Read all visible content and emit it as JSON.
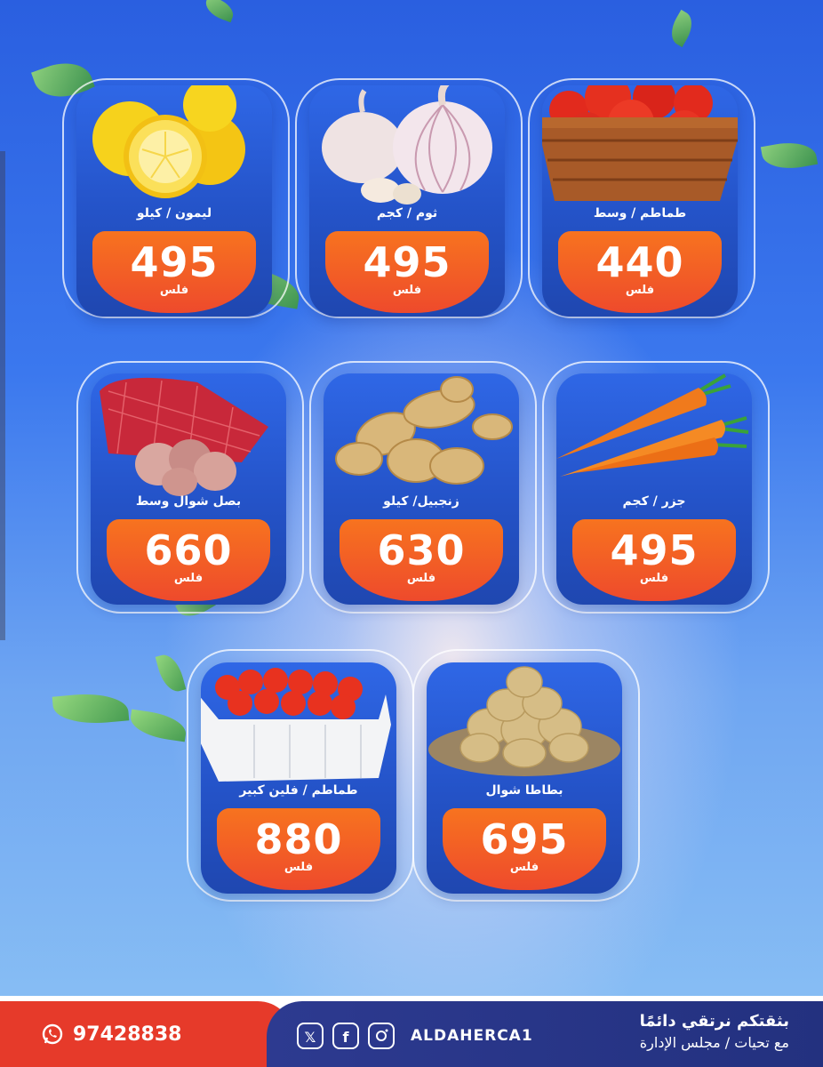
{
  "products": [
    {
      "name": "ليمون / كيلو",
      "price": "495",
      "currency": "فلس",
      "icon": "lemon-icon"
    },
    {
      "name": "ثوم / كجم",
      "price": "495",
      "currency": "فلس",
      "icon": "garlic-icon"
    },
    {
      "name": "طماطم / وسط",
      "price": "440",
      "currency": "فلس",
      "icon": "tomato-basket-icon"
    },
    {
      "name": "بصل شوال وسط",
      "price": "660",
      "currency": "فلس",
      "icon": "onion-sack-icon"
    },
    {
      "name": "زنجبيل/ كيلو",
      "price": "630",
      "currency": "فلس",
      "icon": "ginger-icon"
    },
    {
      "name": "جزر / كجم",
      "price": "495",
      "currency": "فلس",
      "icon": "carrot-icon"
    },
    {
      "name": "طماطم / فلين كبير",
      "price": "880",
      "currency": "فلس",
      "icon": "tomato-box-icon"
    },
    {
      "name": "بطاطا شوال",
      "price": "695",
      "currency": "فلس",
      "icon": "potato-icon"
    }
  ],
  "footer": {
    "phone": "97428838",
    "handle": "ALDAHERCA1",
    "slogan": "بثقتكم نرتقي دائمًا",
    "signature": "مع تحيات / مجلس الإدارة",
    "icons": [
      "whatsapp-icon",
      "x-icon",
      "facebook-icon",
      "instagram-icon"
    ]
  },
  "colors": {
    "accent": "#ee4a2c",
    "brand_navy": "#2d3a90",
    "card_blue": "#2453c8"
  }
}
